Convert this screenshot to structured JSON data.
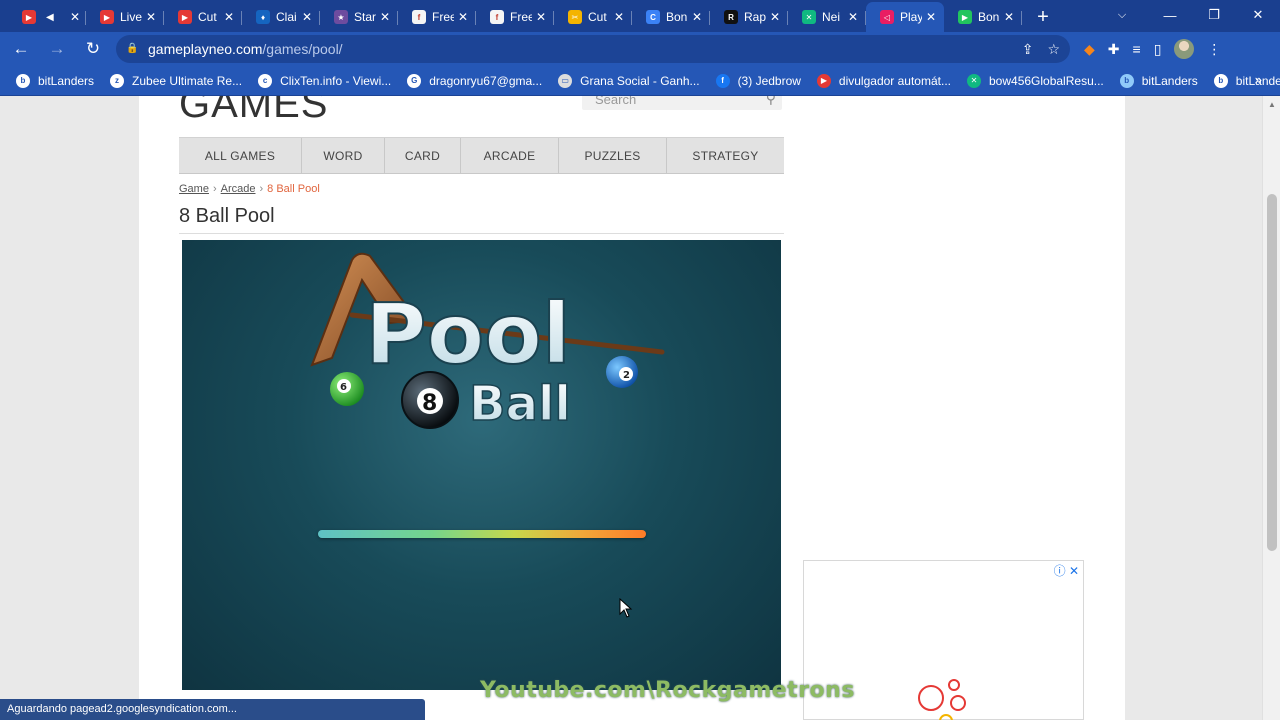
{
  "tabs": [
    {
      "title": "",
      "color": "#e53935",
      "glyph": "▶",
      "extra": "🔊"
    },
    {
      "title": "Live",
      "color": "#e53935",
      "glyph": "▶"
    },
    {
      "title": "Cut",
      "color": "#e53935",
      "glyph": "▶"
    },
    {
      "title": "Clai",
      "color": "#1565c0",
      "glyph": "♦"
    },
    {
      "title": "Star",
      "color": "#6d4c9f",
      "glyph": "★"
    },
    {
      "title": "Free",
      "color": "#f5f5f5",
      "glyph": "f"
    },
    {
      "title": "Free",
      "color": "#f5f5f5",
      "glyph": "f"
    },
    {
      "title": "Cut",
      "color": "#f4b400",
      "glyph": "✂"
    },
    {
      "title": "Bon",
      "color": "#3b82f6",
      "glyph": "C"
    },
    {
      "title": "Rap",
      "color": "#111111",
      "glyph": "R"
    },
    {
      "title": "Nei",
      "color": "#10b981",
      "glyph": "✕"
    },
    {
      "title": "Play",
      "color": "#e91e63",
      "glyph": "◁",
      "active": true
    },
    {
      "title": "Bon",
      "color": "#22c55e",
      "glyph": "▶"
    }
  ],
  "address": {
    "domain": "gameplayneo.com",
    "path": "/games/pool/"
  },
  "bookmarks": [
    {
      "label": "bitLanders",
      "color": "#ffffff",
      "glyph": "b"
    },
    {
      "label": "Zubee Ultimate Re...",
      "color": "#ffffff",
      "glyph": "z"
    },
    {
      "label": "ClixTen.info - Viewi...",
      "color": "#ffffff",
      "glyph": "c"
    },
    {
      "label": "dragonryu67@gma...",
      "color": "#ffffff",
      "glyph": "G"
    },
    {
      "label": "Grana Social - Ganh...",
      "color": "#dddddd",
      "glyph": "▭"
    },
    {
      "label": "(3) Jedbrow",
      "color": "#1877f2",
      "glyph": "f"
    },
    {
      "label": "divulgador automát...",
      "color": "#e53935",
      "glyph": "▶"
    },
    {
      "label": "bow456GlobalResu...",
      "color": "#10b981",
      "glyph": "✕"
    },
    {
      "label": "bitLanders",
      "color": "#90caf9",
      "glyph": "b"
    },
    {
      "label": "bitLanders",
      "color": "#ffffff",
      "glyph": "b"
    }
  ],
  "site": {
    "logo": "GAMES",
    "search_placeholder": "Search",
    "menu": [
      "ALL GAMES",
      "WORD",
      "CARD",
      "ARCADE",
      "PUZZLES",
      "STRATEGY"
    ],
    "breadcrumb": {
      "home": "Game",
      "section": "Arcade",
      "current": "8 Ball Pool"
    },
    "page_title": "8 Ball Pool"
  },
  "game": {
    "title_word_1": "Pool",
    "title_word_2": "Ball",
    "ball_number_center": "8",
    "ball_number_left": "6",
    "ball_number_right": "2",
    "loading_progress": 1.0
  },
  "status_text": "Aguardando pagead2.googlesyndication.com...",
  "watermark": "Youtube.com\\Rockgametrons"
}
